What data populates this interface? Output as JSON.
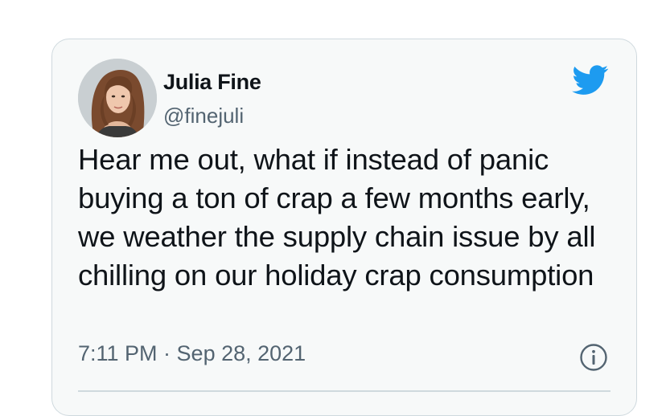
{
  "tweet": {
    "author_name": "Julia Fine",
    "author_handle": "@finejuli",
    "text": "Hear me out, what if instead of panic buying a ton of crap a few months early, we weather the supply chain issue by all chilling on our holiday crap consumption",
    "timestamp": "7:11 PM · Sep 28, 2021"
  },
  "icons": {
    "brand": "twitter-bird-icon",
    "info": "info-icon"
  },
  "colors": {
    "twitter_blue": "#1d9bf0",
    "text_primary": "#0f1419",
    "text_secondary": "#536471",
    "card_background": "#f7f9f9",
    "card_border": "#cfd9de"
  }
}
